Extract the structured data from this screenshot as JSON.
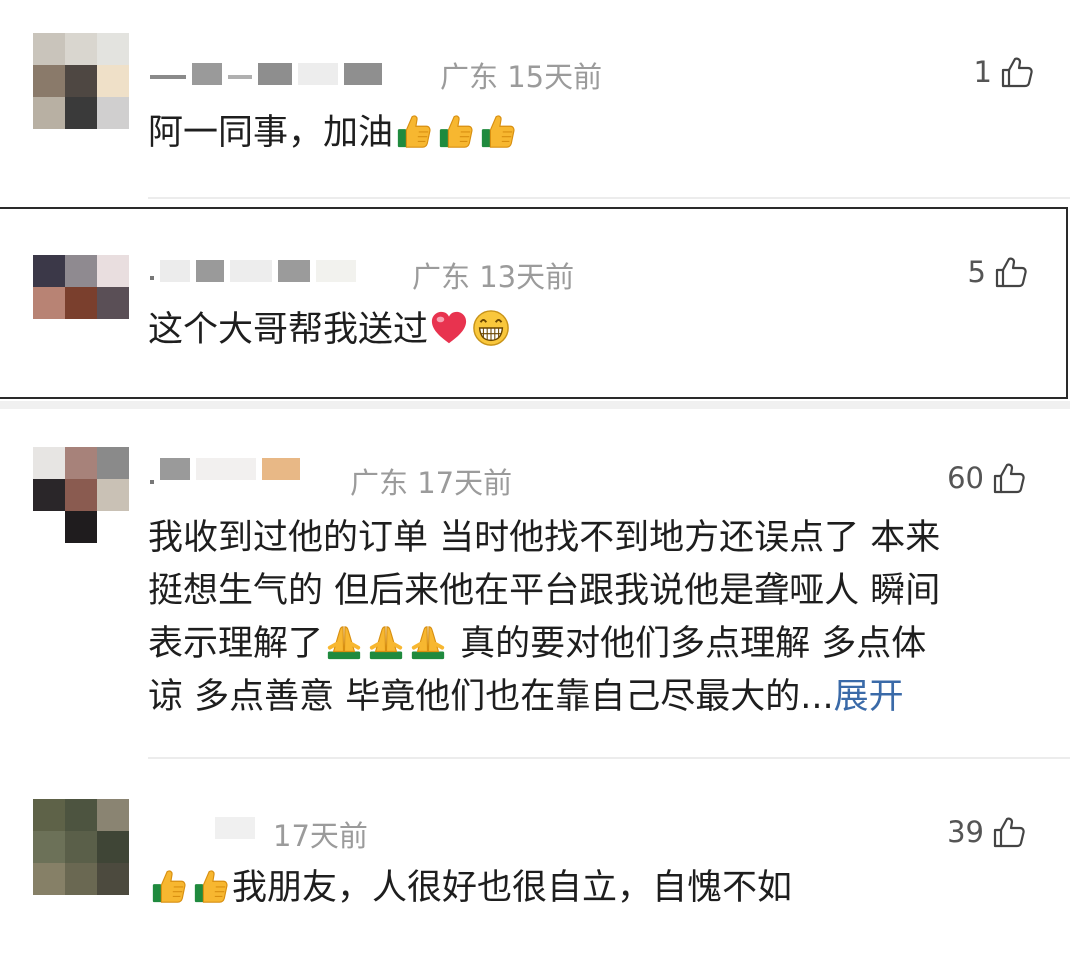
{
  "comments": [
    {
      "location": "广东",
      "time": "15天前",
      "likes": "1",
      "text": "阿一同事，加油",
      "text_emojis": [
        "thumbs-up",
        "thumbs-up",
        "thumbs-up"
      ]
    },
    {
      "location": "广东",
      "time": "13天前",
      "likes": "5",
      "text": "这个大哥帮我送过",
      "text_emojis": [
        "red-heart",
        "grinning-face"
      ]
    },
    {
      "location": "广东",
      "time": "17天前",
      "likes": "60",
      "lines": [
        "我收到过他的订单 当时他找不到地方还误点了 本来",
        "挺想生气的 但后来他在平台跟我说他是聋哑人 瞬间",
        "表示理解了",
        "真的要对他们多点理解 多点体",
        "谅 多点善意 毕竟他们也在靠自己尽最大的..."
      ],
      "expand_label": "展开",
      "text_emojis": [
        "folded-hands",
        "folded-hands",
        "folded-hands"
      ]
    },
    {
      "location": "",
      "time": "17天前",
      "likes": "39",
      "text": "我朋友，人很好也很自立，自愧不如",
      "text_emojis": [
        "thumbs-up",
        "thumbs-up"
      ]
    }
  ],
  "icons": {
    "like": "thumbs-up-outline-icon"
  },
  "colors": {
    "meta_text": "#9b9b9b",
    "expand_link": "#3a6aa8",
    "body_text": "#1e1e1e"
  }
}
